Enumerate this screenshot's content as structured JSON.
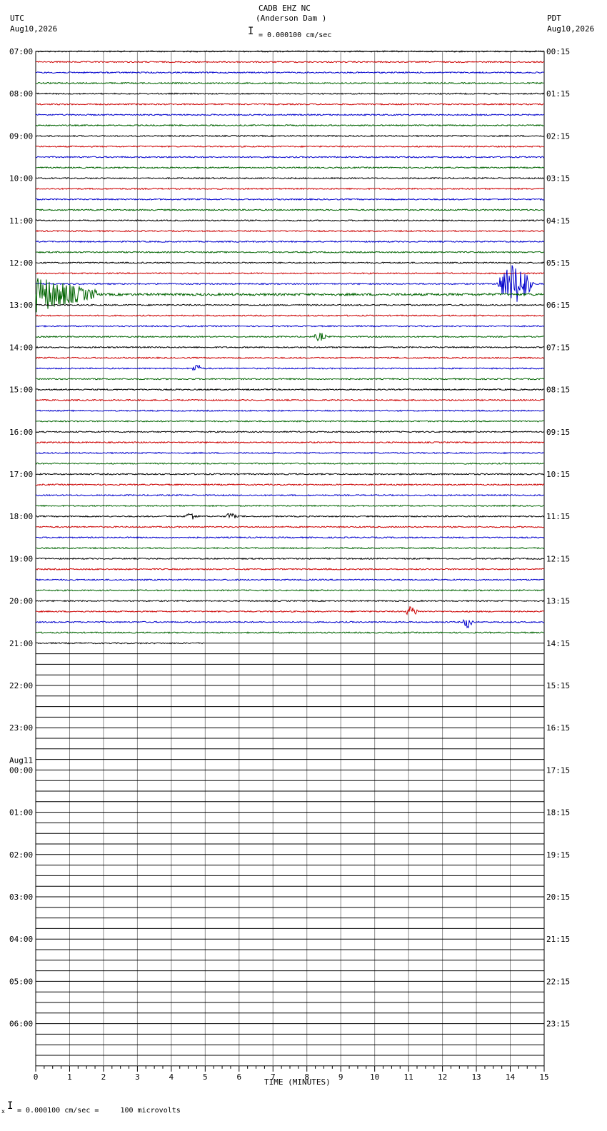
{
  "header": {
    "station": "CADB EHZ NC",
    "location": "(Anderson Dam )",
    "scale_label": "= 0.000100 cm/sec",
    "left_tz": "UTC",
    "left_date": "Aug10,2026",
    "right_tz": "PDT",
    "right_date": "Aug10,2026"
  },
  "footer": {
    "scale_note": "= 0.000100 cm/sec =     100 microvolts",
    "mark": "x"
  },
  "chart_data": {
    "type": "line",
    "title": "CADB EHZ NC",
    "subtitle": "(Anderson Dam )",
    "xlabel": "TIME (MINUTES)",
    "xlim": [
      0,
      15
    ],
    "x_ticks": [
      "0",
      "1",
      "2",
      "3",
      "4",
      "5",
      "6",
      "7",
      "8",
      "9",
      "10",
      "11",
      "12",
      "13",
      "14",
      "15"
    ],
    "minutes_per_line": 15,
    "total_lines": 96,
    "data_lines": 57,
    "last_line_end_minute": 5,
    "trace_colors": [
      "#000000",
      "#cc0000",
      "#0000cc",
      "#006400"
    ],
    "grid": true,
    "left_labels": [
      {
        "line": 0,
        "text": "07:00"
      },
      {
        "line": 4,
        "text": "08:00"
      },
      {
        "line": 8,
        "text": "09:00"
      },
      {
        "line": 12,
        "text": "10:00"
      },
      {
        "line": 16,
        "text": "11:00"
      },
      {
        "line": 20,
        "text": "12:00"
      },
      {
        "line": 24,
        "text": "13:00"
      },
      {
        "line": 28,
        "text": "14:00"
      },
      {
        "line": 32,
        "text": "15:00"
      },
      {
        "line": 36,
        "text": "16:00"
      },
      {
        "line": 40,
        "text": "17:00"
      },
      {
        "line": 44,
        "text": "18:00"
      },
      {
        "line": 48,
        "text": "19:00"
      },
      {
        "line": 52,
        "text": "20:00"
      },
      {
        "line": 56,
        "text": "21:00"
      },
      {
        "line": 60,
        "text": "22:00"
      },
      {
        "line": 64,
        "text": "23:00"
      },
      {
        "line": 68,
        "text": "00:00",
        "date": "Aug11"
      },
      {
        "line": 72,
        "text": "01:00"
      },
      {
        "line": 76,
        "text": "02:00"
      },
      {
        "line": 80,
        "text": "03:00"
      },
      {
        "line": 84,
        "text": "04:00"
      },
      {
        "line": 88,
        "text": "05:00"
      },
      {
        "line": 92,
        "text": "06:00"
      }
    ],
    "right_labels": [
      {
        "line": 0,
        "text": "00:15"
      },
      {
        "line": 4,
        "text": "01:15"
      },
      {
        "line": 8,
        "text": "02:15"
      },
      {
        "line": 12,
        "text": "03:15"
      },
      {
        "line": 16,
        "text": "04:15"
      },
      {
        "line": 20,
        "text": "05:15"
      },
      {
        "line": 24,
        "text": "06:15"
      },
      {
        "line": 28,
        "text": "07:15"
      },
      {
        "line": 32,
        "text": "08:15"
      },
      {
        "line": 36,
        "text": "09:15"
      },
      {
        "line": 40,
        "text": "10:15"
      },
      {
        "line": 44,
        "text": "11:15"
      },
      {
        "line": 48,
        "text": "12:15"
      },
      {
        "line": 52,
        "text": "13:15"
      },
      {
        "line": 56,
        "text": "14:15"
      },
      {
        "line": 60,
        "text": "15:15"
      },
      {
        "line": 64,
        "text": "16:15"
      },
      {
        "line": 68,
        "text": "17:15"
      },
      {
        "line": 72,
        "text": "18:15"
      },
      {
        "line": 76,
        "text": "19:15"
      },
      {
        "line": 80,
        "text": "20:15"
      },
      {
        "line": 84,
        "text": "21:15"
      },
      {
        "line": 88,
        "text": "22:15"
      },
      {
        "line": 92,
        "text": "23:15"
      }
    ],
    "events": [
      {
        "line": 22,
        "start_min": 13.6,
        "end_min": 15.0,
        "amplitude": 2.2
      },
      {
        "line": 23,
        "start_min": 0.0,
        "end_min": 1.8,
        "amplitude": 2.0
      },
      {
        "line": 27,
        "start_min": 8.2,
        "end_min": 8.7,
        "amplitude": 0.4
      },
      {
        "line": 30,
        "start_min": 4.6,
        "end_min": 5.0,
        "amplitude": 0.4
      },
      {
        "line": 44,
        "start_min": 4.4,
        "end_min": 4.9,
        "amplitude": 0.4
      },
      {
        "line": 44,
        "start_min": 5.6,
        "end_min": 6.0,
        "amplitude": 0.4
      },
      {
        "line": 53,
        "start_min": 10.9,
        "end_min": 11.4,
        "amplitude": 0.5
      },
      {
        "line": 54,
        "start_min": 12.6,
        "end_min": 13.0,
        "amplitude": 0.6
      }
    ]
  }
}
